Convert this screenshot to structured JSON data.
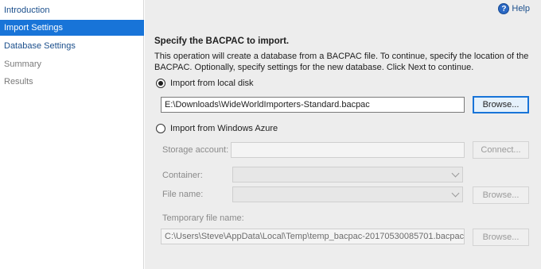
{
  "sidebar": {
    "items": [
      {
        "label": "Introduction",
        "state": "normal"
      },
      {
        "label": "Import Settings",
        "state": "active"
      },
      {
        "label": "Database Settings",
        "state": "normal"
      },
      {
        "label": "Summary",
        "state": "disabled"
      },
      {
        "label": "Results",
        "state": "disabled"
      }
    ]
  },
  "header": {
    "help_label": "Help",
    "help_icon": "question-icon"
  },
  "main": {
    "title": "Specify the BACPAC to import.",
    "description": "This operation will create a database from a BACPAC file. To continue, specify the location of the BACPAC.  Optionally, specify settings for the new database. Click Next to continue.",
    "local": {
      "radio_label": "Import from local disk",
      "checked": true,
      "path_value": "E:\\Downloads\\WideWorldImporters-Standard.bacpac",
      "browse_label": "Browse..."
    },
    "azure": {
      "radio_label": "Import from Windows Azure",
      "checked": false,
      "storage_label": "Storage account:",
      "storage_value": "",
      "connect_label": "Connect...",
      "container_label": "Container:",
      "file_label": "File name:",
      "browse_label": "Browse...",
      "temp_label": "Temporary file name:",
      "temp_value": "C:\\Users\\Steve\\AppData\\Local\\Temp\\temp_bacpac-20170530085701.bacpac",
      "temp_browse_label": "Browse..."
    }
  },
  "colors": {
    "accent": "#1874d8",
    "link": "#1b4f8c",
    "panel": "#ededed"
  }
}
